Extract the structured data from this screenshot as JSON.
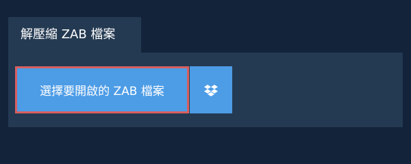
{
  "tab": {
    "label": "解壓縮 ZAB 檔案"
  },
  "upload": {
    "open_button_label": "選擇要開啟的 ZAB 檔案",
    "dropbox_icon": "dropbox-icon"
  },
  "colors": {
    "page_background": "#13233a",
    "panel_background": "#243a52",
    "button_background": "#4d9ce6",
    "button_highlight_border": "#d85f5f",
    "text": "#ffffff"
  }
}
